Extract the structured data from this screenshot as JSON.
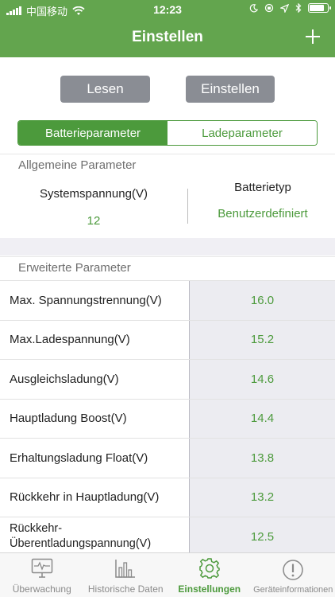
{
  "status_bar": {
    "carrier": "中国移动",
    "time": "12:23"
  },
  "nav": {
    "title": "Einstellen",
    "add_icon": "plus-icon"
  },
  "actions": {
    "read_label": "Lesen",
    "set_label": "Einstellen"
  },
  "segment": {
    "tabs": [
      "Batterieparameter",
      "Ladeparameter"
    ],
    "selected": "Batterieparameter"
  },
  "general": {
    "header": "Allgemeine Parameter",
    "system_voltage_label": "Systemspannung(V)",
    "system_voltage_value": "12",
    "battery_type_label": "Batterietyp",
    "battery_type_value": "Benutzerdefiniert"
  },
  "advanced": {
    "header": "Erweiterte Parameter",
    "rows": [
      {
        "label": "Max. Spannungstrennung(V)",
        "value": "16.0"
      },
      {
        "label": "Max.Ladespannung(V)",
        "value": "15.2"
      },
      {
        "label": "Ausgleichsladung(V)",
        "value": "14.6"
      },
      {
        "label": "Hauptladung Boost(V)",
        "value": "14.4"
      },
      {
        "label": "Erhaltungsladung Float(V)",
        "value": "13.8"
      },
      {
        "label": "Rückkehr in Hauptladung(V)",
        "value": "13.2"
      },
      {
        "label": "Rückkehr-Überentladungspannung(V)",
        "value": "12.5"
      }
    ]
  },
  "tabbar": {
    "items": [
      {
        "label": "Überwachung",
        "icon": "monitor-icon"
      },
      {
        "label": "Historische Daten",
        "icon": "bar-chart-icon"
      },
      {
        "label": "Einstellungen",
        "icon": "gear-icon"
      },
      {
        "label": "Geräteinformationen",
        "icon": "info-icon"
      }
    ],
    "active": "Einstellungen"
  },
  "colors": {
    "brand_green": "#63a54e",
    "accent_green": "#4c9a3c",
    "button_gray": "#8a8d94"
  }
}
